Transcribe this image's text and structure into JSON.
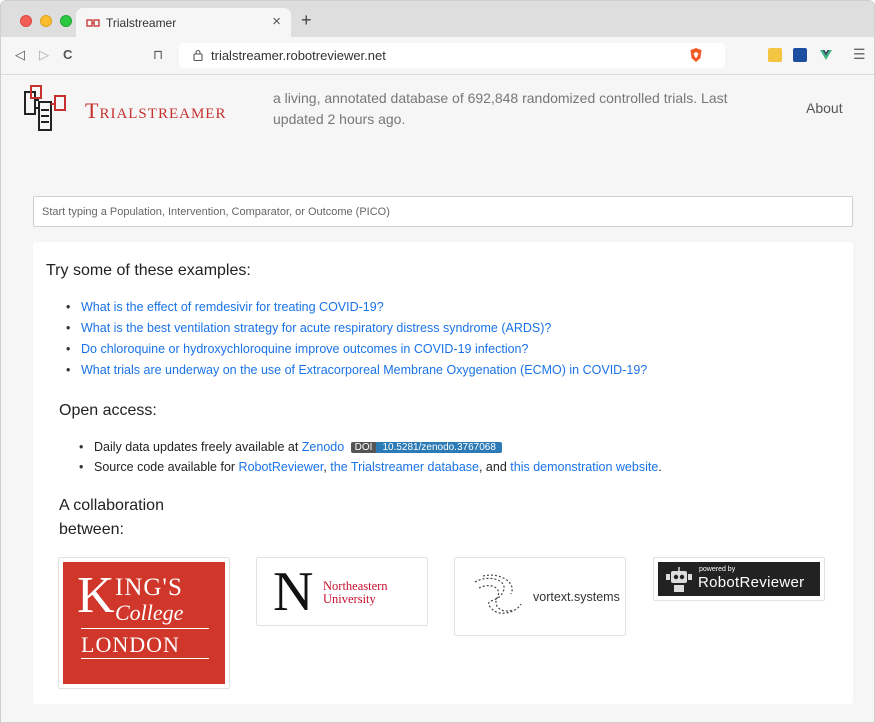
{
  "browser": {
    "tab_title": "Trialstreamer",
    "tab_close": "×",
    "new_tab": "+",
    "url": "trialstreamer.robotreviewer.net",
    "back": "◁",
    "forward": "▷",
    "reload": "C",
    "bookmark": "⊓",
    "menu": "☰"
  },
  "header": {
    "brand": "Trialstreamer",
    "tagline": "a living, annotated database of 692,848 randomized controlled trials. Last updated 2 hours ago.",
    "about": "About"
  },
  "search": {
    "placeholder": "Start typing a Population, Intervention, Comparator, or Outcome (PICO)"
  },
  "examples": {
    "heading": "Try some of these examples:",
    "items": [
      "What is the effect of remdesivir for treating COVID-19?",
      "What is the best ventilation strategy for acute respiratory distress syndrome (ARDS)?",
      "Do chloroquine or hydroxychloroquine improve outcomes in COVID-19 infection?",
      "What trials are underway on the use of Extracorporeal Membrane Oxygenation (ECMO) in COVID-19?"
    ]
  },
  "open_access": {
    "heading": "Open access:",
    "line1_prefix": "Daily data updates freely available at",
    "zenodo": "Zenodo",
    "doi_label": "DOI",
    "doi_value": "10.5281/zenodo.3767068",
    "line2_prefix": "Source code available for",
    "robotreviewer": "RobotReviewer",
    "comma": ",",
    "db_link": "the Trialstreamer database",
    "and": ", and",
    "demo_link": "this demonstration website",
    "period": "."
  },
  "collab": {
    "heading": "A collaboration between:",
    "kings": {
      "k": "K",
      "ings": "ING'S",
      "college": "College",
      "london": "LONDON"
    },
    "northeastern": {
      "n": "N",
      "line1": "Northeastern",
      "line2": "University"
    },
    "vortext": "vortext.systems",
    "robot": {
      "powered": "powered by",
      "name": "RobotReviewer"
    }
  },
  "colors": {
    "brand_red": "#c5312f",
    "link_blue": "#1a73e8",
    "kings_red": "#d1362a",
    "doi_blue": "#2d7bb6"
  }
}
